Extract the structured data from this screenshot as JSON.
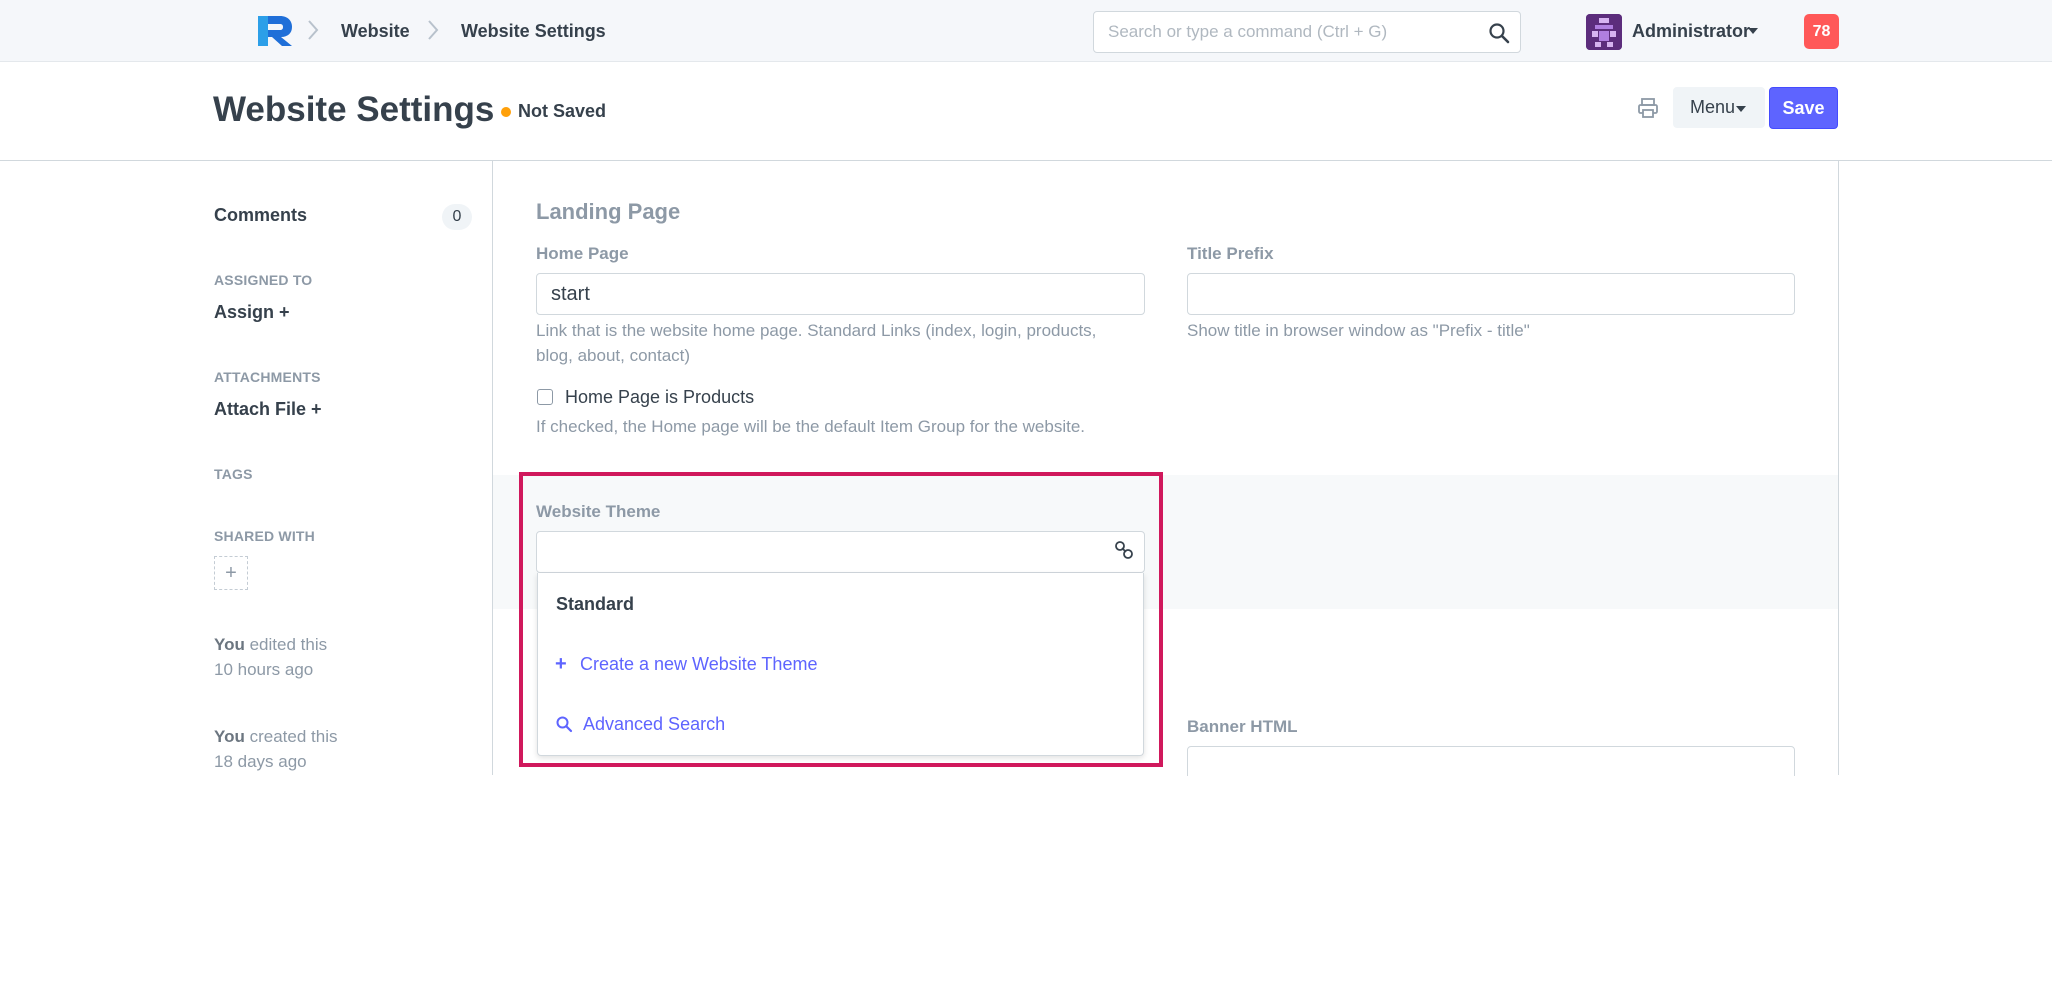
{
  "navbar": {
    "logo": "R",
    "breadcrumbs": [
      "Website",
      "Website Settings"
    ],
    "search_placeholder": "Search or type a command (Ctrl + G)",
    "user_name": "Administrator",
    "notification_count": "78"
  },
  "page": {
    "title": "Website Settings",
    "status": "Not Saved",
    "menu_label": "Menu",
    "save_label": "Save"
  },
  "sidebar": {
    "comments_label": "Comments",
    "comments_count": "0",
    "assigned_to_label": "ASSIGNED TO",
    "assign_label": "Assign",
    "attachments_label": "ATTACHMENTS",
    "attach_label": "Attach File",
    "tags_label": "TAGS",
    "shared_with_label": "SHARED WITH",
    "timeline": [
      {
        "who": "You",
        "action": "edited this",
        "when": "10 hours ago"
      },
      {
        "who": "You",
        "action": "created this",
        "when": "18 days ago"
      }
    ]
  },
  "form": {
    "section_title": "Landing Page",
    "home_page_label": "Home Page",
    "home_page_value": "start",
    "home_page_help": "Link that is the website home page. Standard Links (index, login, products, blog, about, contact)",
    "title_prefix_label": "Title Prefix",
    "title_prefix_value": "",
    "title_prefix_help": "Show title in browser window as \"Prefix - title\"",
    "home_is_products_label": "Home Page is Products",
    "home_is_products_help": "If checked, the Home page will be the default Item Group for the website.",
    "website_theme_label": "Website Theme",
    "website_theme_value": "",
    "banner_html_label": "Banner HTML"
  },
  "dropdown": {
    "items": [
      "Standard",
      "Create a new Website Theme",
      "Advanced Search"
    ]
  },
  "colors": {
    "primary": "#5e64ff",
    "highlight": "#d0185c",
    "status_dot": "#ffa00a",
    "notification": "#ff5858"
  }
}
